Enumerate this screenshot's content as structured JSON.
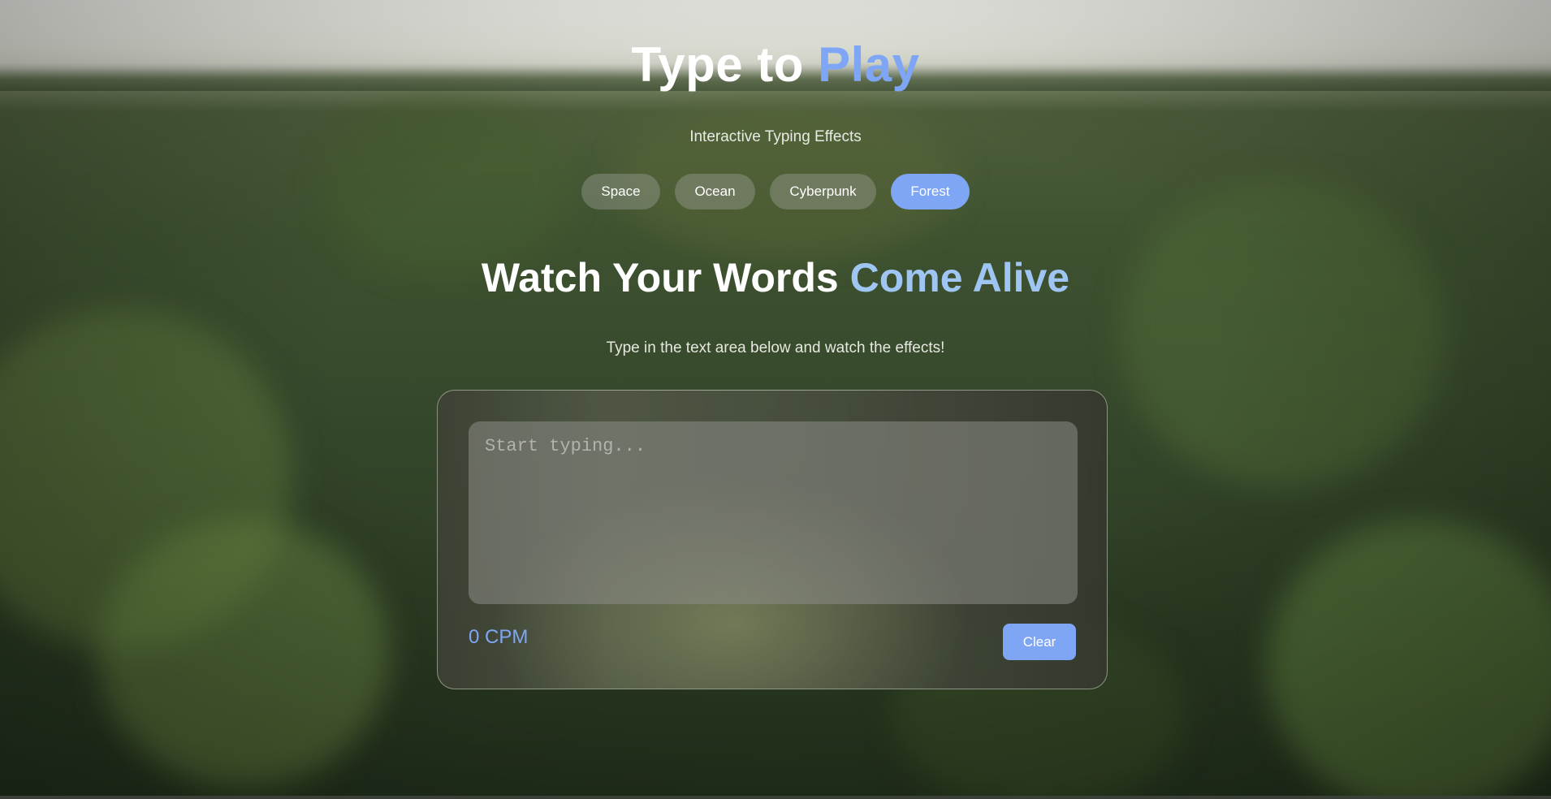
{
  "header": {
    "title_main": "Type to",
    "title_accent": "Play",
    "tagline": "Interactive Typing Effects"
  },
  "themes": [
    {
      "label": "Space",
      "active": false
    },
    {
      "label": "Ocean",
      "active": false
    },
    {
      "label": "Cyberpunk",
      "active": false
    },
    {
      "label": "Forest",
      "active": true
    }
  ],
  "hero": {
    "headline_main": "Watch Your Words",
    "headline_accent": "Come Alive",
    "subline": "Type in the text area below and watch the effects!"
  },
  "editor": {
    "placeholder": "Start typing...",
    "value": ""
  },
  "stats": {
    "cpm": "0 CPM"
  },
  "actions": {
    "clear_label": "Clear"
  },
  "colors": {
    "accent": "#7fa6f5",
    "headline_accent": "#9fc6f3",
    "background_theme": "forest"
  }
}
